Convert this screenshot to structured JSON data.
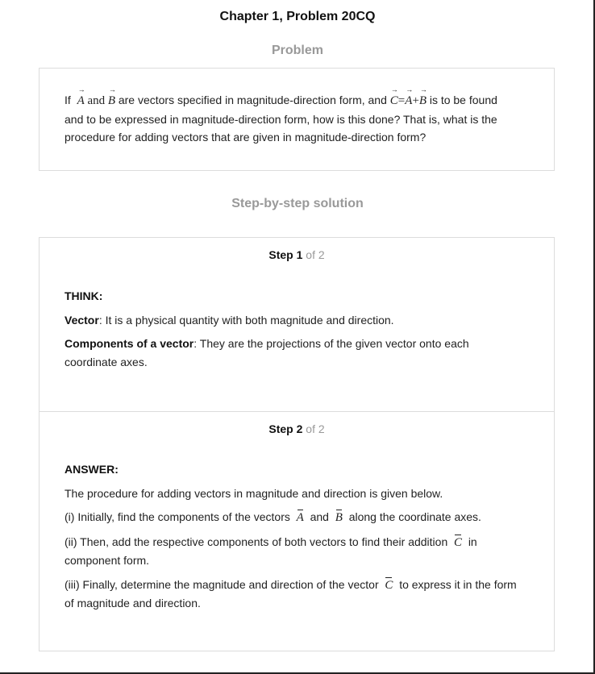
{
  "page": {
    "title": "Chapter 1, Problem 20CQ",
    "problem_label": "Problem",
    "solution_label": "Step-by-step solution"
  },
  "problem": {
    "if": "If",
    "vec_A": "A",
    "vec_B": "B",
    "vec_C": "C",
    "and_word": "and",
    "part1": "are vectors specified in magnitude-direction form, and",
    "equals": "=",
    "plus": "+",
    "part2": "is to be found",
    "line2": "and to be expressed in magnitude-direction form, how is this done? That is, what is the",
    "line3": "procedure for adding vectors that are given in magnitude-direction form?"
  },
  "steps": [
    {
      "word": "Step",
      "number": "1",
      "of": "of 2",
      "heading": "THINK:",
      "vector_term": "Vector",
      "vector_def": ": It is a physical quantity with both magnitude and direction.",
      "comp_term": "Components of a vector",
      "comp_def_line1": ": They are the projections of the given vector onto each",
      "comp_def_line2": "coordinate axes."
    },
    {
      "word": "Step",
      "number": "2",
      "of": "of 2",
      "heading": "ANSWER:",
      "intro": "The procedure for adding vectors in magnitude and direction is given below.",
      "i_a": "(i) Initially, find the components of the vectors",
      "i_and": "and",
      "i_b": "along the coordinate axes.",
      "ii_a": "(ii) Then, add the respective components of both vectors to find their addition",
      "ii_in": "in",
      "ii_line2": "component form.",
      "iii_a": "(iii) Finally, determine the magnitude and direction of the vector",
      "iii_b": "to express it in the form",
      "iii_line2": "of magnitude and direction.",
      "sym_A": "A",
      "sym_B": "B",
      "sym_C": "C"
    }
  ]
}
